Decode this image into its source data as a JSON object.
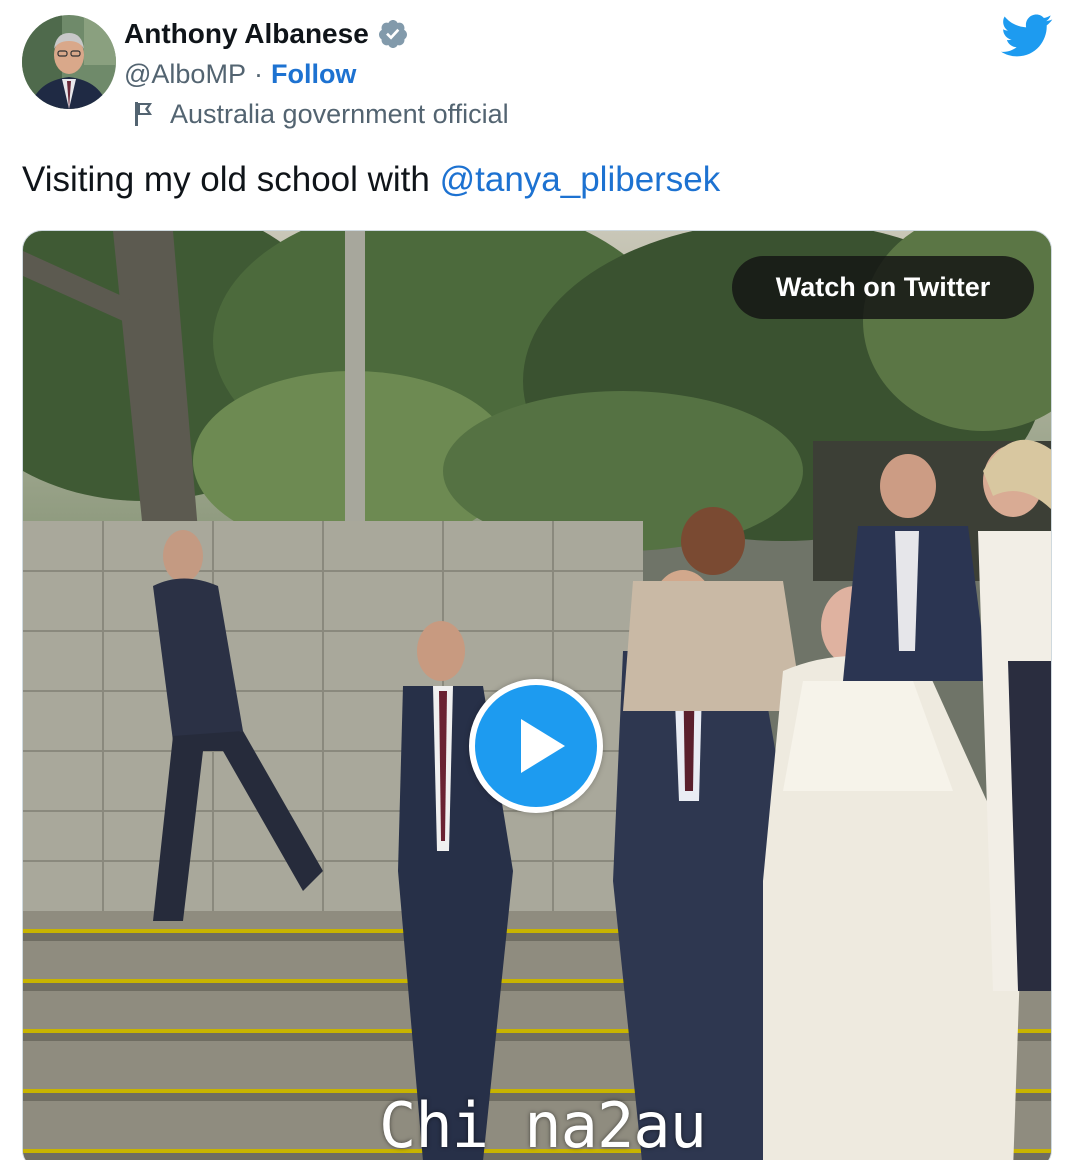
{
  "author": {
    "display_name": "Anthony Albanese",
    "handle": "@AlboMP",
    "separator": "·",
    "follow_label": "Follow",
    "label": "Australia government official",
    "verified_icon": "verified-badge-icon",
    "flag_icon": "flag-icon"
  },
  "brand": {
    "logo_icon": "twitter-bird-icon",
    "accent_color": "#1d9bf0",
    "link_color": "#1d72d1"
  },
  "tweet": {
    "text": "Visiting my old school with ",
    "mention": "@tanya_plibersek"
  },
  "media": {
    "watch_label": "Watch on Twitter",
    "play_icon": "play-icon",
    "watermark": "Chi na2au"
  }
}
